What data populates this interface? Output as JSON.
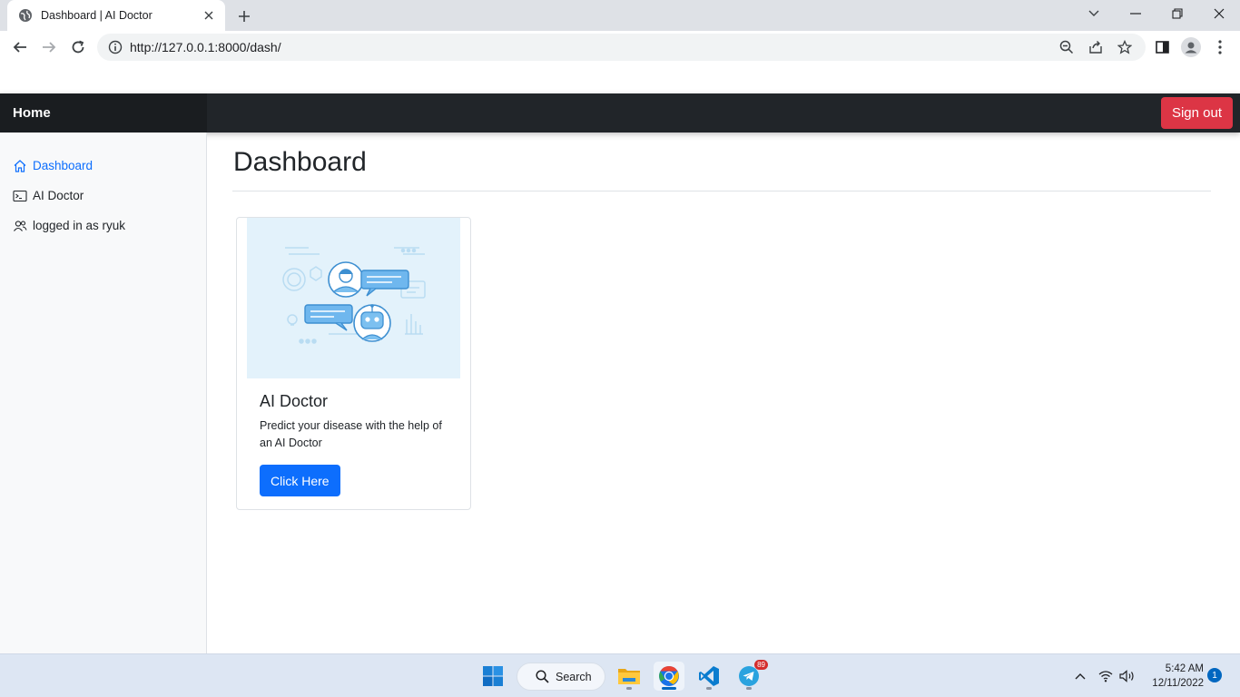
{
  "browser": {
    "tab_title": "Dashboard | AI Doctor",
    "url": "http://127.0.0.1:8000/dash/"
  },
  "navbar": {
    "brand": "Home",
    "signout_label": "Sign out"
  },
  "sidebar": {
    "items": [
      {
        "label": "Dashboard",
        "icon": "house-icon",
        "active": true
      },
      {
        "label": "AI Doctor",
        "icon": "terminal-icon",
        "active": false
      },
      {
        "label": "logged in as ryuk",
        "icon": "people-icon",
        "active": false
      }
    ]
  },
  "main": {
    "title": "Dashboard",
    "card": {
      "title": "AI Doctor",
      "text": "Predict your disease with the help of an AI Doctor",
      "button_label": "Click Here",
      "image": "ai-doctor-chat-illustration"
    }
  },
  "taskbar": {
    "search_label": "Search",
    "telegram_badge": "89",
    "time": "5:42 AM",
    "date": "12/11/2022",
    "notification_count": "1"
  },
  "colors": {
    "navbar": "#212529",
    "signout": "#dc3545",
    "primary": "#0d6efd",
    "sidebar_bg": "#f8f9fa"
  }
}
